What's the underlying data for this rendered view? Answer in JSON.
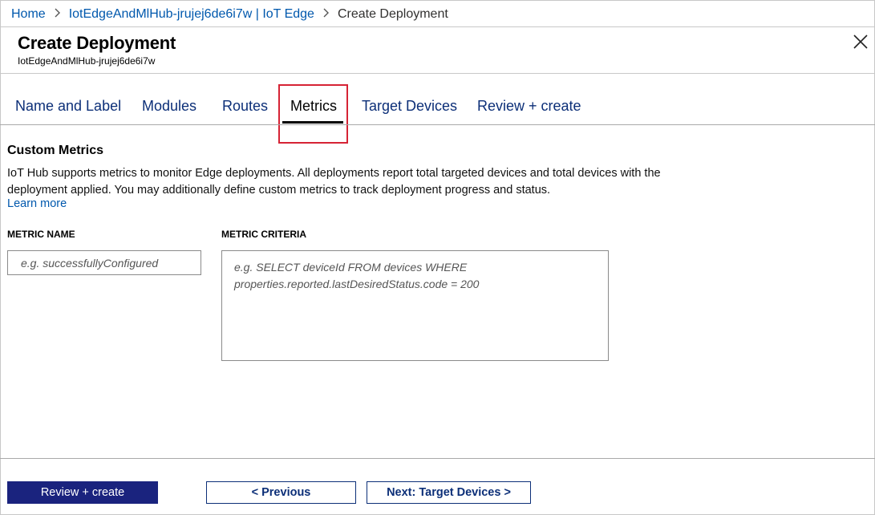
{
  "breadcrumb": {
    "home": "Home",
    "hub": "IotEdgeAndMlHub-jrujej6de6i7w | IoT Edge",
    "current": "Create Deployment"
  },
  "header": {
    "title": "Create Deployment",
    "subtitle": "IotEdgeAndMlHub-jrujej6de6i7w"
  },
  "tabs": [
    {
      "label": "Name and Label"
    },
    {
      "label": "Modules"
    },
    {
      "label": "Routes"
    },
    {
      "label": "Metrics"
    },
    {
      "label": "Target Devices"
    },
    {
      "label": "Review + create"
    }
  ],
  "active_tab": "Metrics",
  "section": {
    "title": "Custom Metrics",
    "description": "IoT Hub supports metrics to monitor Edge deployments. All deployments report total targeted devices and total devices with the deployment applied. You may additionally define custom metrics to track deployment progress and status.",
    "learn_more": "Learn more"
  },
  "form": {
    "metric_name_label": "METRIC NAME",
    "metric_name_placeholder": "e.g. successfullyConfigured",
    "metric_name_value": "",
    "metric_criteria_label": "METRIC CRITERIA",
    "metric_criteria_placeholder": "e.g. SELECT deviceId FROM devices WHERE properties.reported.lastDesiredStatus.code = 200",
    "metric_criteria_value": ""
  },
  "footer": {
    "review_create": "Review + create",
    "previous": "< Previous",
    "next": "Next: Target Devices >"
  },
  "colors": {
    "link": "#0058ad",
    "tab_text": "#0c2f78",
    "primary_button": "#1a237e",
    "highlight_box": "#d62335"
  },
  "icons": {
    "breadcrumb_separator": "chevron-right-icon",
    "close": "close-icon"
  }
}
